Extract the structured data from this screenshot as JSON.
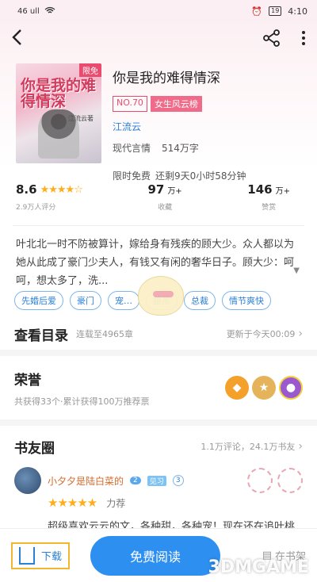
{
  "status": {
    "left": "46 ull",
    "time": "4:10",
    "battery": "19"
  },
  "book": {
    "cover_badge": "限免",
    "cover_title": "你是我的难得情深",
    "cover_author": "江流云著",
    "title": "你是我的难得情深",
    "rank_no": "NO.70",
    "rank_name": "女生风云榜",
    "author": "江流云",
    "genre": "现代言情",
    "words": "514万字",
    "free_text": "限时免费",
    "free_remaining": "还剩9天0小时58分钟"
  },
  "stats": {
    "score": "8.6",
    "score_sub": "2.9万人评分",
    "stars": "★★★★☆",
    "collect_value": "97",
    "collect_unit": "万+",
    "collect_label": "收藏",
    "like_value": "146",
    "like_unit": "万+",
    "like_label": "赞赏"
  },
  "synopsis": "叶北北一时不防被算计，嫁给身有残疾的顾大少。众人都以为她从此成了豪门少夫人，有钱又有闲的奢华日子。顾大少：呵呵，想太多了，洗...",
  "chips": [
    "先婚后爱",
    "豪门",
    "宠…",
    "腹黑",
    "总裁",
    "情节爽快"
  ],
  "catalog": {
    "title": "查看目录",
    "serial": "连载至4965章",
    "update": "更新于今天00:09"
  },
  "honor": {
    "title": "荣誉",
    "sub": "共获得33个·累计获得100万推荐票"
  },
  "circle": {
    "title": "书友圈",
    "stat": "1.1万评论，24.1万书友"
  },
  "comment": {
    "user": "小夕夕是陆白菜的",
    "level": "2",
    "badge": "见习",
    "fan": "3",
    "stars": "★★★★★",
    "rating_text": "力荐",
    "text": "超级喜欢云云的文，各种甜，各种宠！现在还在追叶桃夭那本呢！上一本叶清滢的也看了，都巨"
  },
  "bottom": {
    "download": "下载",
    "read": "免费阅读",
    "shelf": "在书架"
  },
  "watermark": "3DMGAME"
}
